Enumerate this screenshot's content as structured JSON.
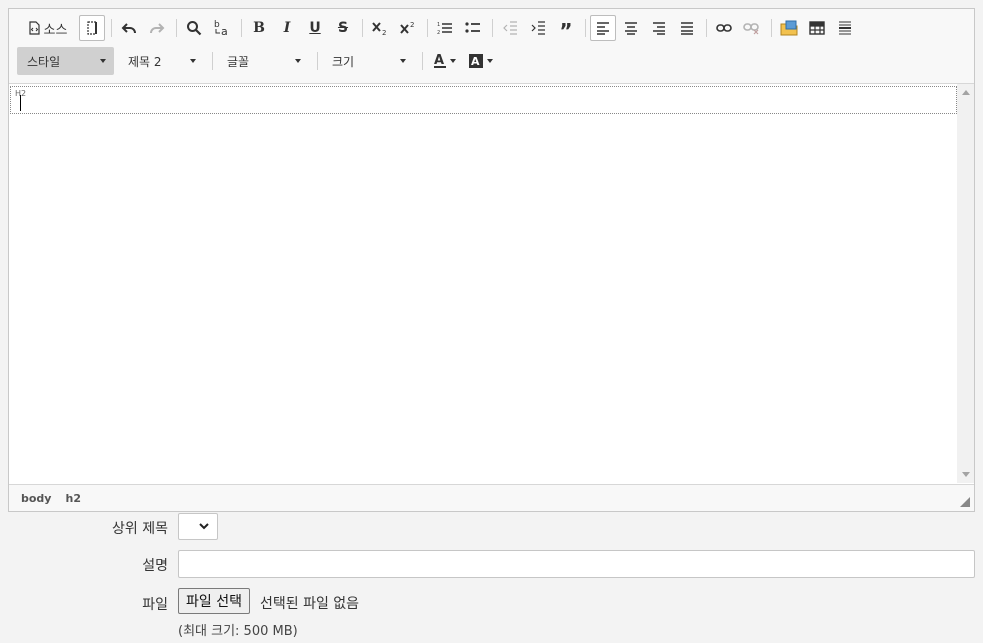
{
  "toolbar": {
    "source_label": "소스",
    "style_combo": "스타일",
    "heading_combo": "제목 2",
    "font_combo": "글꼴",
    "size_combo": "크기",
    "icons": [
      "source-icon",
      "show-blocks-icon",
      "undo-icon",
      "redo-icon",
      "find-icon",
      "replace-icon",
      "bold-icon",
      "italic-icon",
      "underline-icon",
      "strikethrough-icon",
      "subscript-icon",
      "superscript-icon",
      "numbered-list-icon",
      "bulleted-list-icon",
      "decrease-indent-icon",
      "increase-indent-icon",
      "blockquote-icon",
      "align-left-icon",
      "align-center-icon",
      "align-right-icon",
      "justify-icon",
      "link-icon",
      "unlink-icon",
      "image-icon",
      "table-icon",
      "horizontal-line-icon",
      "text-color-icon",
      "background-color-icon"
    ]
  },
  "content": {
    "block_tag": "H2"
  },
  "path_bar": [
    "body",
    "h2"
  ],
  "form": {
    "parent_label": "상위 제목",
    "description_label": "설명",
    "file_label": "파일",
    "file_button": "파일 선택",
    "file_status": "선택된 파일 없음",
    "file_hint": "(최대 크기: 500 MB)"
  }
}
